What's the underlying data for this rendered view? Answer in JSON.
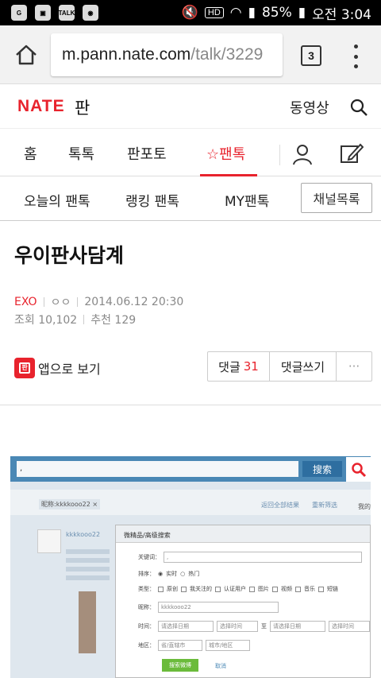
{
  "status": {
    "battery": "85%",
    "time": "오전 3:04",
    "hd": "HD"
  },
  "browser": {
    "url_host": "m.pann.nate.com",
    "url_path": "/talk/3229",
    "tab_count": "3"
  },
  "header": {
    "logo": "NATE",
    "logo_sub": "판",
    "video": "동영상"
  },
  "gnb": {
    "items": [
      "홈",
      "톡톡",
      "판포토",
      "☆팬톡"
    ]
  },
  "subnav": {
    "items": [
      "오늘의 팬톡",
      "랭킹 팬톡",
      "MY팬톡"
    ],
    "channel": "채널목록"
  },
  "post": {
    "title": "우이판사담계",
    "author": "EXO",
    "nick": "ㅇㅇ",
    "date": "2014.06.12 20:30",
    "views": "조회 10,102",
    "recommend": "추천 129"
  },
  "actions": {
    "app_view": "앱으로 보기",
    "comments_label": "댓글",
    "comments_count": "31",
    "write_comment": "댓글쓰기",
    "more": "···"
  },
  "shot": {
    "search_value": ",",
    "search_btn": "搜索",
    "tag": "昵称:kkkkooo22 ×",
    "link1": "返回全部结果",
    "link2": "重新筛选",
    "right_text": "我的",
    "name": "kkkkooo22",
    "dialog_title": "微精品/高级搜索",
    "keyword_label": "关键词：",
    "keyword_value": ",",
    "sort_label": "排序：",
    "sort_opt1": "实时",
    "sort_opt2": "热门",
    "type_label": "类型：",
    "types": [
      "原创",
      "我关注的",
      "认证用户",
      "图片",
      "视频",
      "音乐",
      "短链"
    ],
    "nick_label": "昵称：",
    "nick_value": "kkkkooo22",
    "time_label": "时间：",
    "time_start": "请选择日期",
    "time_start_h": "选择时间",
    "to": "至",
    "time_end": "请选择日期",
    "time_end_h": "选择时间",
    "area_label": "地区：",
    "area1": "省/直辖市",
    "area2": "城市/地区",
    "go": "搜索微博",
    "cancel": "取消"
  }
}
